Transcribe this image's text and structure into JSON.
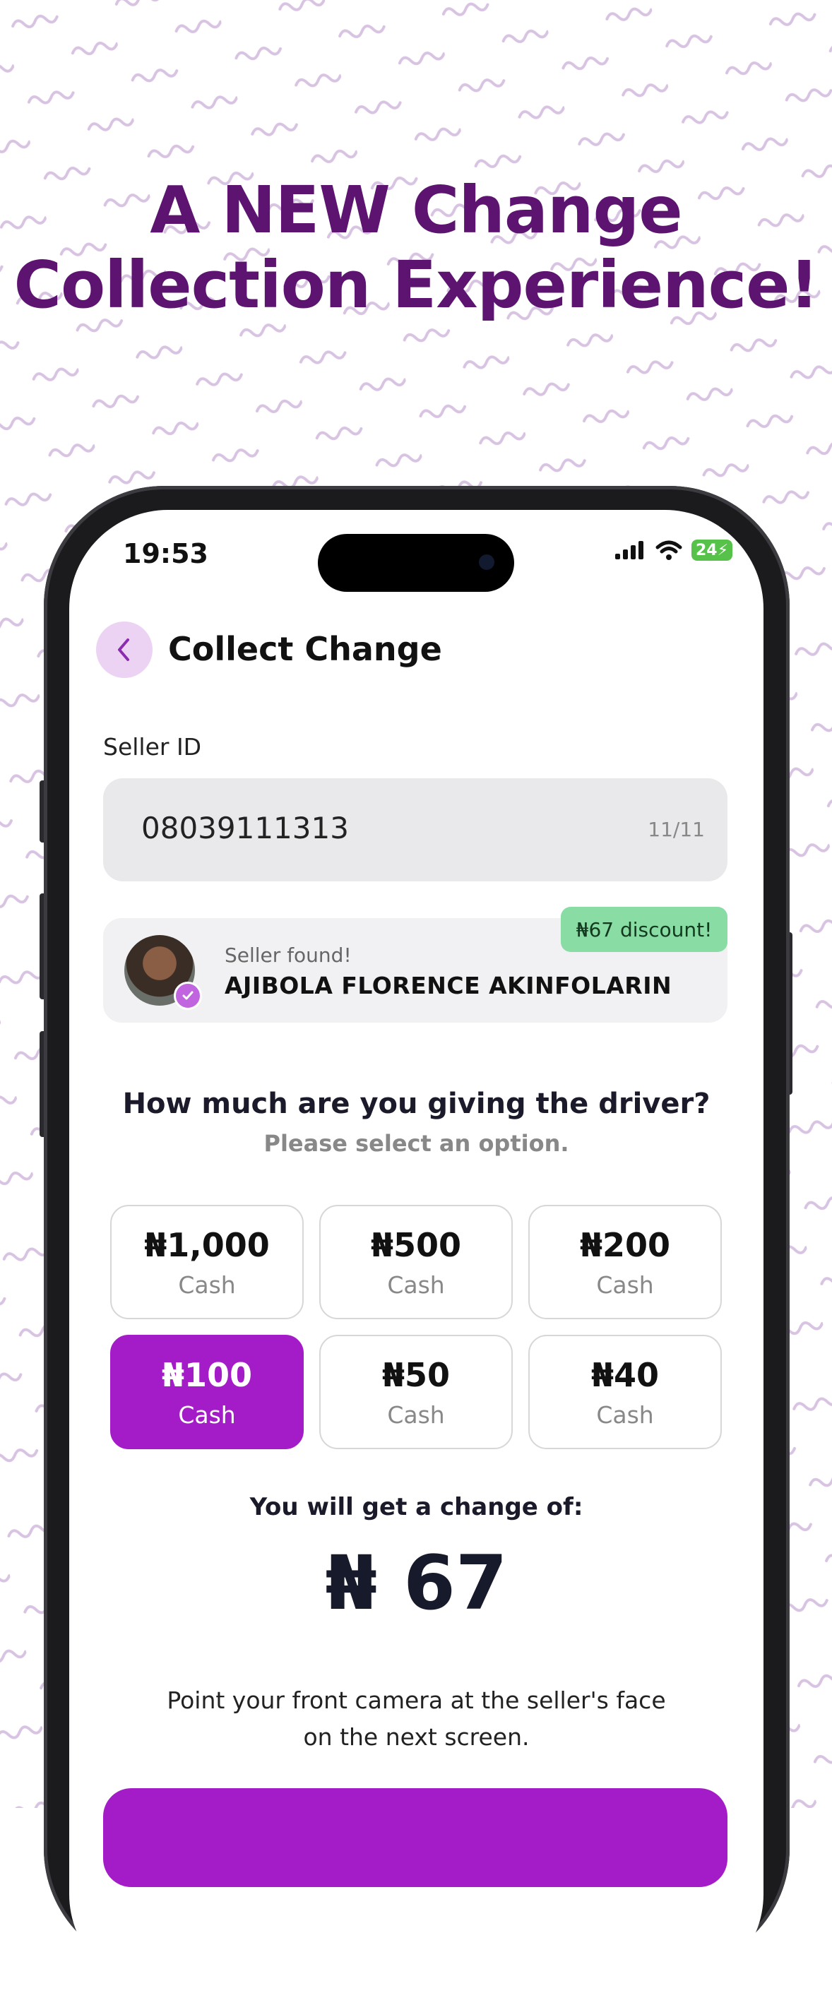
{
  "headline": {
    "line1": "A  NEW Change",
    "line2": "Collection Experience!"
  },
  "status_bar": {
    "time": "19:53",
    "battery": "24"
  },
  "header": {
    "title": "Collect Change"
  },
  "seller_id": {
    "label": "Seller ID",
    "value": "08039111313",
    "counter": "11/11"
  },
  "seller": {
    "found_label": "Seller found!",
    "name": "AJIBOLA FLORENCE AKINFOLARIN",
    "discount_badge": "₦67 discount!"
  },
  "question": {
    "title": "How much are you giving the driver?",
    "subtitle": "Please select an option."
  },
  "options": [
    {
      "amount": "₦1,000",
      "type": "Cash",
      "selected": false
    },
    {
      "amount": "₦500",
      "type": "Cash",
      "selected": false
    },
    {
      "amount": "₦200",
      "type": "Cash",
      "selected": false
    },
    {
      "amount": "₦100",
      "type": "Cash",
      "selected": true
    },
    {
      "amount": "₦50",
      "type": "Cash",
      "selected": false
    },
    {
      "amount": "₦40",
      "type": "Cash",
      "selected": false
    }
  ],
  "change": {
    "label": "You will get a change of:",
    "amount": "₦ 67"
  },
  "instruction": {
    "line1": "Point your front camera at the seller's face",
    "line2": "on the next screen."
  },
  "colors": {
    "brand_purple": "#a41cc7",
    "headline_purple": "#5c1470",
    "badge_green": "#89dca4"
  }
}
